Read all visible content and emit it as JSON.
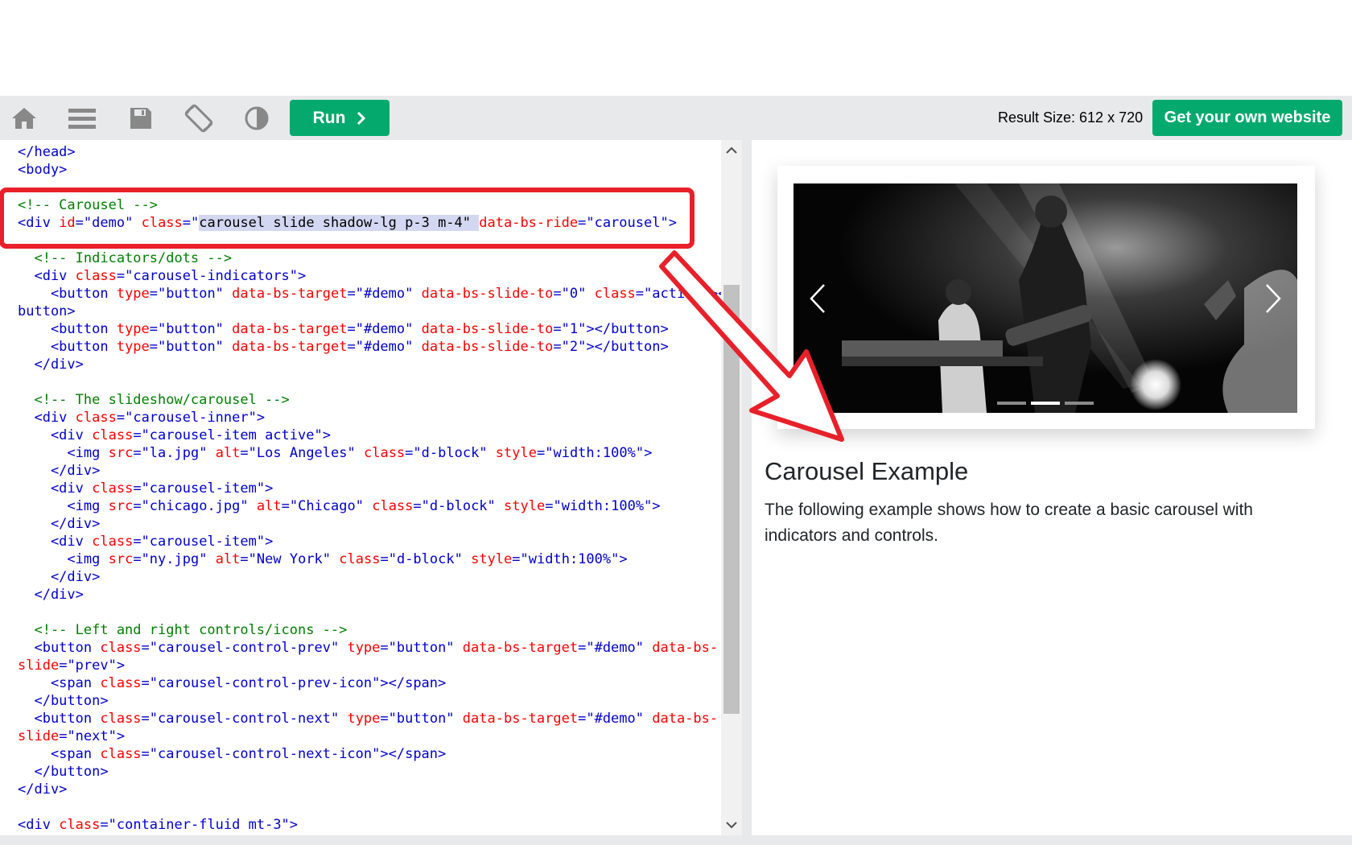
{
  "toolbar": {
    "run_label": "Run",
    "result_size": "Result Size: 612 x 720",
    "own_website_label": "Get your own website",
    "icons": [
      "home-icon",
      "menu-icon",
      "save-icon",
      "rotate-icon",
      "contrast-icon"
    ]
  },
  "editor": {
    "lines": [
      [
        [
          "t",
          "</head>"
        ]
      ],
      [
        [
          "t",
          "<body>"
        ]
      ],
      [],
      [
        [
          "c",
          "<!-- Carousel -->"
        ]
      ],
      [
        [
          "t",
          "<div "
        ],
        [
          "a",
          "id"
        ],
        [
          "t",
          "="
        ],
        [
          "v",
          "\"demo\""
        ],
        [
          "t",
          " "
        ],
        [
          "a",
          "class"
        ],
        [
          "t",
          "=\""
        ],
        [
          "sel",
          "carousel slide shadow-lg p-3 m-4\" "
        ],
        [
          "a",
          "data-bs-ride"
        ],
        [
          "t",
          "="
        ],
        [
          "v",
          "\"carousel\""
        ],
        [
          "t",
          ">"
        ]
      ],
      [],
      [
        [
          "c",
          "  <!-- Indicators/dots -->"
        ]
      ],
      [
        [
          "t",
          "  <div "
        ],
        [
          "a",
          "class"
        ],
        [
          "t",
          "="
        ],
        [
          "v",
          "\"carousel-indicators\""
        ],
        [
          "t",
          ">"
        ]
      ],
      [
        [
          "t",
          "    <button "
        ],
        [
          "a",
          "type"
        ],
        [
          "t",
          "="
        ],
        [
          "v",
          "\"button\""
        ],
        [
          "t",
          " "
        ],
        [
          "a",
          "data-bs-target"
        ],
        [
          "t",
          "="
        ],
        [
          "v",
          "\"#demo\""
        ],
        [
          "t",
          " "
        ],
        [
          "a",
          "data-bs-slide-to"
        ],
        [
          "t",
          "="
        ],
        [
          "v",
          "\"0\""
        ],
        [
          "t",
          " "
        ],
        [
          "a",
          "class"
        ],
        [
          "t",
          "="
        ],
        [
          "v",
          "\"active\""
        ],
        [
          "t",
          "></"
        ]
      ],
      [
        [
          "t",
          "button>"
        ]
      ],
      [
        [
          "t",
          "    <button "
        ],
        [
          "a",
          "type"
        ],
        [
          "t",
          "="
        ],
        [
          "v",
          "\"button\""
        ],
        [
          "t",
          " "
        ],
        [
          "a",
          "data-bs-target"
        ],
        [
          "t",
          "="
        ],
        [
          "v",
          "\"#demo\""
        ],
        [
          "t",
          " "
        ],
        [
          "a",
          "data-bs-slide-to"
        ],
        [
          "t",
          "="
        ],
        [
          "v",
          "\"1\""
        ],
        [
          "t",
          "></button>"
        ]
      ],
      [
        [
          "t",
          "    <button "
        ],
        [
          "a",
          "type"
        ],
        [
          "t",
          "="
        ],
        [
          "v",
          "\"button\""
        ],
        [
          "t",
          " "
        ],
        [
          "a",
          "data-bs-target"
        ],
        [
          "t",
          "="
        ],
        [
          "v",
          "\"#demo\""
        ],
        [
          "t",
          " "
        ],
        [
          "a",
          "data-bs-slide-to"
        ],
        [
          "t",
          "="
        ],
        [
          "v",
          "\"2\""
        ],
        [
          "t",
          "></button>"
        ]
      ],
      [
        [
          "t",
          "  </div>"
        ]
      ],
      [],
      [
        [
          "c",
          "  <!-- The slideshow/carousel -->"
        ]
      ],
      [
        [
          "t",
          "  <div "
        ],
        [
          "a",
          "class"
        ],
        [
          "t",
          "="
        ],
        [
          "v",
          "\"carousel-inner\""
        ],
        [
          "t",
          ">"
        ]
      ],
      [
        [
          "t",
          "    <div "
        ],
        [
          "a",
          "class"
        ],
        [
          "t",
          "="
        ],
        [
          "v",
          "\"carousel-item active\""
        ],
        [
          "t",
          ">"
        ]
      ],
      [
        [
          "t",
          "      <img "
        ],
        [
          "a",
          "src"
        ],
        [
          "t",
          "="
        ],
        [
          "v",
          "\"la.jpg\""
        ],
        [
          "t",
          " "
        ],
        [
          "a",
          "alt"
        ],
        [
          "t",
          "="
        ],
        [
          "v",
          "\"Los Angeles\""
        ],
        [
          "t",
          " "
        ],
        [
          "a",
          "class"
        ],
        [
          "t",
          "="
        ],
        [
          "v",
          "\"d-block\""
        ],
        [
          "t",
          " "
        ],
        [
          "a",
          "style"
        ],
        [
          "t",
          "="
        ],
        [
          "v",
          "\"width:100%\""
        ],
        [
          "t",
          ">"
        ]
      ],
      [
        [
          "t",
          "    </div>"
        ]
      ],
      [
        [
          "t",
          "    <div "
        ],
        [
          "a",
          "class"
        ],
        [
          "t",
          "="
        ],
        [
          "v",
          "\"carousel-item\""
        ],
        [
          "t",
          ">"
        ]
      ],
      [
        [
          "t",
          "      <img "
        ],
        [
          "a",
          "src"
        ],
        [
          "t",
          "="
        ],
        [
          "v",
          "\"chicago.jpg\""
        ],
        [
          "t",
          " "
        ],
        [
          "a",
          "alt"
        ],
        [
          "t",
          "="
        ],
        [
          "v",
          "\"Chicago\""
        ],
        [
          "t",
          " "
        ],
        [
          "a",
          "class"
        ],
        [
          "t",
          "="
        ],
        [
          "v",
          "\"d-block\""
        ],
        [
          "t",
          " "
        ],
        [
          "a",
          "style"
        ],
        [
          "t",
          "="
        ],
        [
          "v",
          "\"width:100%\""
        ],
        [
          "t",
          ">"
        ]
      ],
      [
        [
          "t",
          "    </div>"
        ]
      ],
      [
        [
          "t",
          "    <div "
        ],
        [
          "a",
          "class"
        ],
        [
          "t",
          "="
        ],
        [
          "v",
          "\"carousel-item\""
        ],
        [
          "t",
          ">"
        ]
      ],
      [
        [
          "t",
          "      <img "
        ],
        [
          "a",
          "src"
        ],
        [
          "t",
          "="
        ],
        [
          "v",
          "\"ny.jpg\""
        ],
        [
          "t",
          " "
        ],
        [
          "a",
          "alt"
        ],
        [
          "t",
          "="
        ],
        [
          "v",
          "\"New York\""
        ],
        [
          "t",
          " "
        ],
        [
          "a",
          "class"
        ],
        [
          "t",
          "="
        ],
        [
          "v",
          "\"d-block\""
        ],
        [
          "t",
          " "
        ],
        [
          "a",
          "style"
        ],
        [
          "t",
          "="
        ],
        [
          "v",
          "\"width:100%\""
        ],
        [
          "t",
          ">"
        ]
      ],
      [
        [
          "t",
          "    </div>"
        ]
      ],
      [
        [
          "t",
          "  </div>"
        ]
      ],
      [],
      [
        [
          "c",
          "  <!-- Left and right controls/icons -->"
        ]
      ],
      [
        [
          "t",
          "  <button "
        ],
        [
          "a",
          "class"
        ],
        [
          "t",
          "="
        ],
        [
          "v",
          "\"carousel-control-prev\""
        ],
        [
          "t",
          " "
        ],
        [
          "a",
          "type"
        ],
        [
          "t",
          "="
        ],
        [
          "v",
          "\"button\""
        ],
        [
          "t",
          " "
        ],
        [
          "a",
          "data-bs-target"
        ],
        [
          "t",
          "="
        ],
        [
          "v",
          "\"#demo\""
        ],
        [
          "t",
          " "
        ],
        [
          "a",
          "data-bs-"
        ]
      ],
      [
        [
          "a",
          "slide"
        ],
        [
          "t",
          "="
        ],
        [
          "v",
          "\"prev\""
        ],
        [
          "t",
          ">"
        ]
      ],
      [
        [
          "t",
          "    <span "
        ],
        [
          "a",
          "class"
        ],
        [
          "t",
          "="
        ],
        [
          "v",
          "\"carousel-control-prev-icon\""
        ],
        [
          "t",
          "></span>"
        ]
      ],
      [
        [
          "t",
          "  </button>"
        ]
      ],
      [
        [
          "t",
          "  <button "
        ],
        [
          "a",
          "class"
        ],
        [
          "t",
          "="
        ],
        [
          "v",
          "\"carousel-control-next\""
        ],
        [
          "t",
          " "
        ],
        [
          "a",
          "type"
        ],
        [
          "t",
          "="
        ],
        [
          "v",
          "\"button\""
        ],
        [
          "t",
          " "
        ],
        [
          "a",
          "data-bs-target"
        ],
        [
          "t",
          "="
        ],
        [
          "v",
          "\"#demo\""
        ],
        [
          "t",
          " "
        ],
        [
          "a",
          "data-bs-"
        ]
      ],
      [
        [
          "a",
          "slide"
        ],
        [
          "t",
          "="
        ],
        [
          "v",
          "\"next\""
        ],
        [
          "t",
          ">"
        ]
      ],
      [
        [
          "t",
          "    <span "
        ],
        [
          "a",
          "class"
        ],
        [
          "t",
          "="
        ],
        [
          "v",
          "\"carousel-control-next-icon\""
        ],
        [
          "t",
          "></span>"
        ]
      ],
      [
        [
          "t",
          "  </button>"
        ]
      ],
      [
        [
          "t",
          "</div>"
        ]
      ],
      [],
      [
        [
          "t",
          "<div "
        ],
        [
          "a",
          "class"
        ],
        [
          "t",
          "="
        ],
        [
          "v",
          "\"container-fluid mt-3\""
        ],
        [
          "t",
          ">"
        ]
      ]
    ]
  },
  "result": {
    "heading": "Carousel Example",
    "paragraph": "The following example shows how to create a basic carousel with indicators and controls.",
    "indicator_count": 3,
    "active_indicator": 1
  },
  "colors": {
    "accent_green": "#04aa6d",
    "toolbar_bg": "#e7e9eb",
    "annotation_red": "#e8202a",
    "tag_blue": "#0000cd",
    "attr_red": "#ff0000",
    "comment_green": "#008000"
  }
}
